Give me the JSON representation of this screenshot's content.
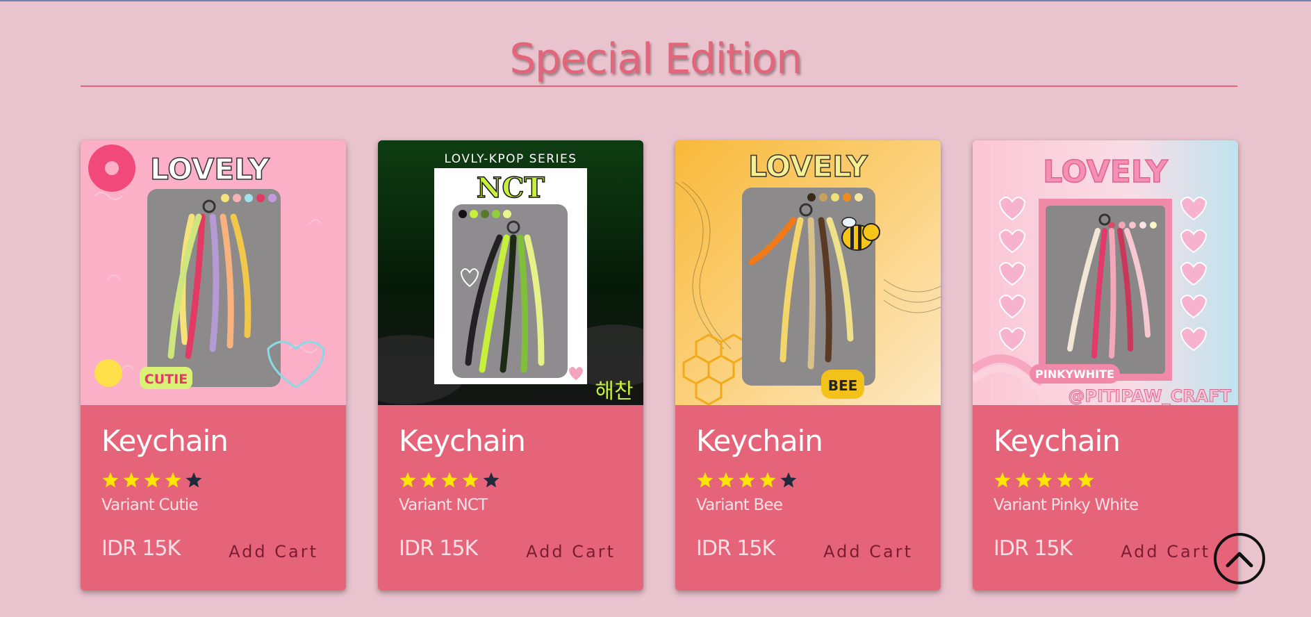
{
  "section": {
    "title": "Special Edition"
  },
  "colors": {
    "accent": "#e2657a",
    "card": "#e6647a",
    "background": "#e9c3ce",
    "star_on": "#ffe600",
    "star_off": "#1f2a3d"
  },
  "back_to_top": {
    "icon": "chevron-up-icon"
  },
  "cards": [
    {
      "title": "Keychain",
      "rating": 4,
      "rating_max": 5,
      "variant": "Variant Cutie",
      "price": "IDR 15K",
      "cta": "Add Cart",
      "image": {
        "headline": "LOVELY",
        "tag": "CUTIE"
      }
    },
    {
      "title": "Keychain",
      "rating": 4,
      "rating_max": 5,
      "variant": "Variant NCT",
      "price": "IDR 15K",
      "cta": "Add Cart",
      "image": {
        "series": "LOVLY-KPOP SERIES",
        "headline": "NCT",
        "side_tag": "해찬"
      }
    },
    {
      "title": "Keychain",
      "rating": 4,
      "rating_max": 5,
      "variant": "Variant Bee",
      "price": "IDR 15K",
      "cta": "Add Cart",
      "image": {
        "headline": "LOVELY",
        "tag": "BEE"
      }
    },
    {
      "title": "Keychain",
      "rating": 5,
      "rating_max": 5,
      "variant": "Variant Pinky White",
      "price": "IDR 15K",
      "cta": "Add Cart",
      "image": {
        "headline": "LOVELY",
        "tag": "PINKYWHITE",
        "handle": "@PITIPAW_CRAFT"
      }
    }
  ]
}
